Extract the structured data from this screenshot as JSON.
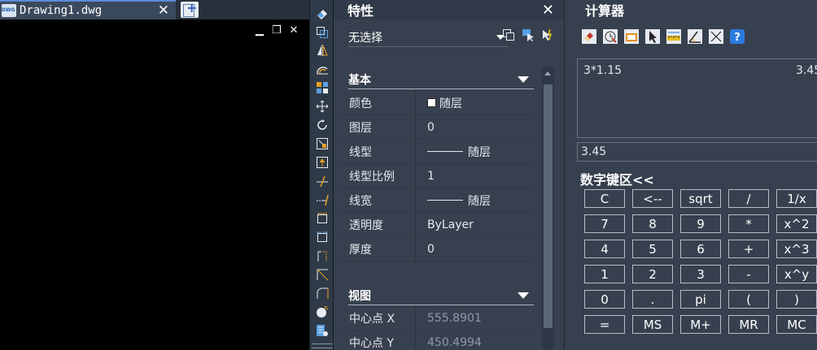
{
  "drawing": {
    "tab_title": "Drawing1.dwg",
    "tab_close": "✕",
    "minimize": "▁",
    "restore": "❐",
    "close": "✕"
  },
  "toolstrip": {
    "icons": [
      "eraser-icon",
      "copy-icon",
      "mirror-icon",
      "offset-icon",
      "array-icon",
      "move-icon",
      "rotate-icon",
      "scale-icon",
      "stretch-icon",
      "trim-icon",
      "extend-icon",
      "break-icon",
      "break-at-point-icon",
      "join-icon",
      "chamfer-icon",
      "fillet-icon",
      "explode-icon",
      "properties-icon"
    ]
  },
  "properties": {
    "title": "特性",
    "close": "✕",
    "selection": "无选择",
    "sections": {
      "basic": {
        "title": "基本",
        "rows": [
          {
            "name": "颜色",
            "value": "随层"
          },
          {
            "name": "图层",
            "value": "0"
          },
          {
            "name": "线型",
            "value": "随层"
          },
          {
            "name": "线型比例",
            "value": "1"
          },
          {
            "name": "线宽",
            "value": "随层"
          },
          {
            "name": "透明度",
            "value": "ByLayer"
          },
          {
            "name": "厚度",
            "value": "0"
          }
        ]
      },
      "view": {
        "title": "视图",
        "rows": [
          {
            "name": "中心点 X",
            "value": "555.8901"
          },
          {
            "name": "中心点 Y",
            "value": "450.4994"
          }
        ]
      }
    }
  },
  "calculator": {
    "title": "计算器",
    "close": "✕",
    "toolbar_icons": [
      "clear-icon",
      "clear-history-icon",
      "get-coordinates-icon",
      "pick-point-icon",
      "distance-icon",
      "angle-icon",
      "intersection-icon",
      "help-icon"
    ],
    "history_expression": "3*1.15",
    "history_result": "3.45",
    "input_value": "3.45",
    "keypad_title": "数字键区<<",
    "keys": [
      [
        "C",
        "<--",
        "sqrt",
        "/",
        "1/x"
      ],
      [
        "7",
        "8",
        "9",
        "*",
        "x^2"
      ],
      [
        "4",
        "5",
        "6",
        "+",
        "x^3"
      ],
      [
        "1",
        "2",
        "3",
        "-",
        "x^y"
      ],
      [
        "0",
        ".",
        "pi",
        "(",
        ")"
      ],
      [
        "=",
        "MS",
        "M+",
        "MR",
        "MC"
      ]
    ]
  }
}
